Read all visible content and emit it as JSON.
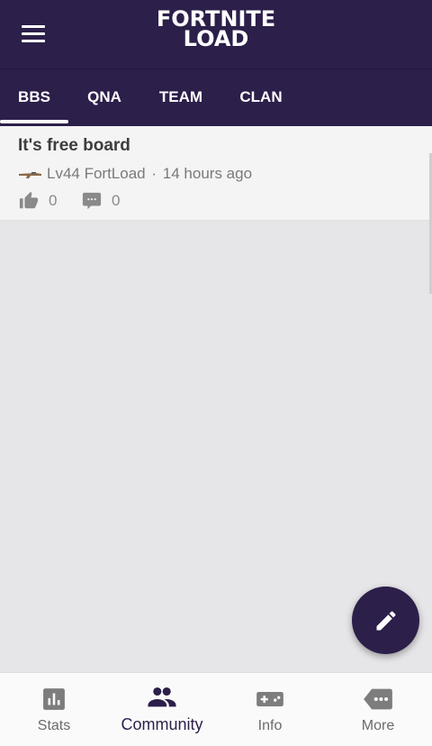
{
  "header": {
    "logo_line1": "FORTNITE",
    "logo_line2": "LOAD"
  },
  "tabs": [
    {
      "label": "BBS",
      "active": true
    },
    {
      "label": "QNA",
      "active": false
    },
    {
      "label": "TEAM",
      "active": false
    },
    {
      "label": "CLAN",
      "active": false
    }
  ],
  "post": {
    "title": "It's free board",
    "author": "Lv44 FortLoad",
    "separator": "·",
    "time": "14 hours ago",
    "likes": "0",
    "comments": "0"
  },
  "bottom_nav": [
    {
      "label": "Stats",
      "icon": "bar-chart-icon",
      "active": false
    },
    {
      "label": "Community",
      "icon": "people-icon",
      "active": true
    },
    {
      "label": "Info",
      "icon": "gamepad-icon",
      "active": false
    },
    {
      "label": "More",
      "icon": "more-tag-icon",
      "active": false
    }
  ],
  "colors": {
    "primary": "#2c1f4a",
    "background": "#e6e6e8",
    "icon_gray": "#7d7d7d"
  }
}
